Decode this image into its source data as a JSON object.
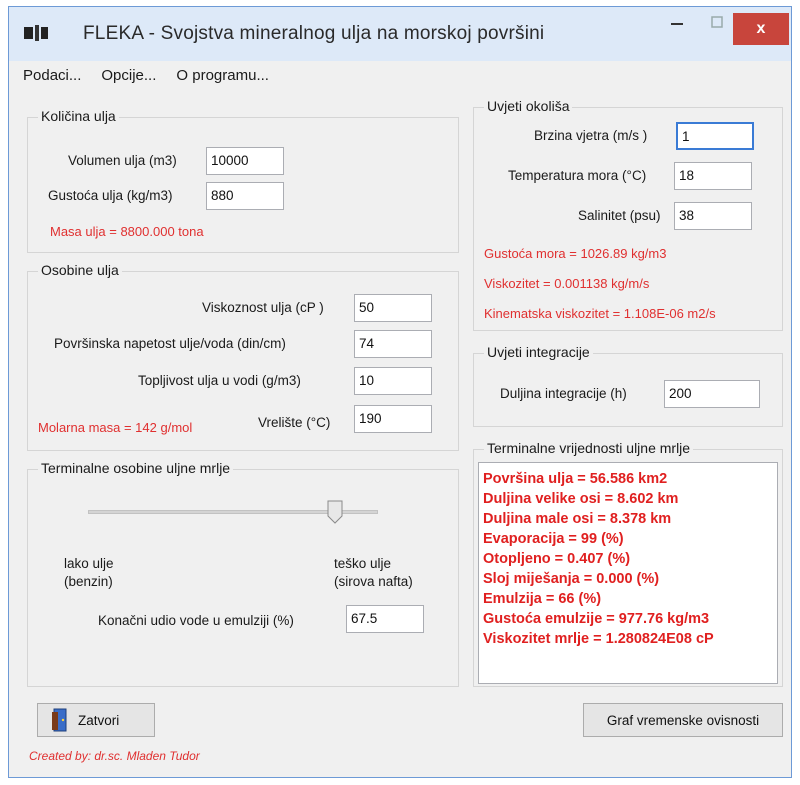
{
  "window": {
    "title": "FLEKA - Svojstva mineralnog ulja na morskoj površini",
    "close_label": "x"
  },
  "menu": {
    "items": [
      "Podaci...",
      "Opcije...",
      "O programu..."
    ]
  },
  "kolicina": {
    "title": "Količina ulja",
    "volumen_label": "Volumen ulja (m3)",
    "volumen_value": "10000",
    "gustoca_label": "Gustoća ulja (kg/m3)",
    "gustoca_value": "880",
    "masa_text": "Masa ulja = 8800.000 tona"
  },
  "osobine": {
    "title": "Osobine ulja",
    "viskoznost_label": "Viskoznost ulja (cP )",
    "viskoznost_value": "50",
    "napetost_label": "Površinska napetost ulje/voda (din/cm)",
    "napetost_value": "74",
    "topljivost_label": "Topljivost ulja u vodi (g/m3)",
    "topljivost_value": "10",
    "vreliste_label": "Vrelište (°C)",
    "vreliste_value": "190",
    "molarna_text": "Molarna masa = 142 g/mol"
  },
  "terminalne_osobine": {
    "title": "Terminalne osobine uljne mrlje",
    "slider_position": 0.85,
    "lako_label": "lako ulje",
    "lako_sub": "(benzin)",
    "tesko_label": "teško ulje",
    "tesko_sub": "(sirova nafta)",
    "udio_label": "Konačni udio vode u emulziji (%)",
    "udio_value": "67.5"
  },
  "uvjeti_okolisa": {
    "title": "Uvjeti okoliša",
    "brzina_label": "Brzina vjetra (m/s )",
    "brzina_value": "1",
    "temperatura_label": "Temperatura mora (°C)",
    "temperatura_value": "18",
    "salinitet_label": "Salinitet (psu)",
    "salinitet_value": "38",
    "gustoca_mora_text": "Gustoća mora = 1026.89 kg/m3",
    "viskozitet_text": "Viskozitet = 0.001138 kg/m/s",
    "kinematska_text": "Kinematska viskozitet = 1.108E-06 m2/s"
  },
  "uvjeti_integracije": {
    "title": "Uvjeti integracije",
    "duljina_label": "Duljina integracije (h)",
    "duljina_value": "200"
  },
  "terminalne_vrijednosti": {
    "title": "Terminalne vrijednosti uljne mrlje",
    "lines": [
      "Površina ulja = 56.586 km2",
      "Duljina velike osi = 8.602 km",
      "Duljina male osi = 8.378 km",
      "Evaporacija = 99 (%)",
      "Otopljeno = 0.407 (%)",
      "Sloj miješanja = 0.000 (%)",
      "Emulzija = 66 (%)",
      "Gustoća emulzije = 977.76 kg/m3",
      "Viskozitet mrlje = 1.280824E08 cP"
    ]
  },
  "buttons": {
    "zatvori": "Zatvori",
    "graf": "Graf vremenske ovisnosti"
  },
  "footer": {
    "created_by": "Created by: dr.sc. Mladen Tudor"
  },
  "colors": {
    "accent_red": "#e03030",
    "close_button": "#c8453c",
    "window_bg": "#f0f0f0"
  }
}
